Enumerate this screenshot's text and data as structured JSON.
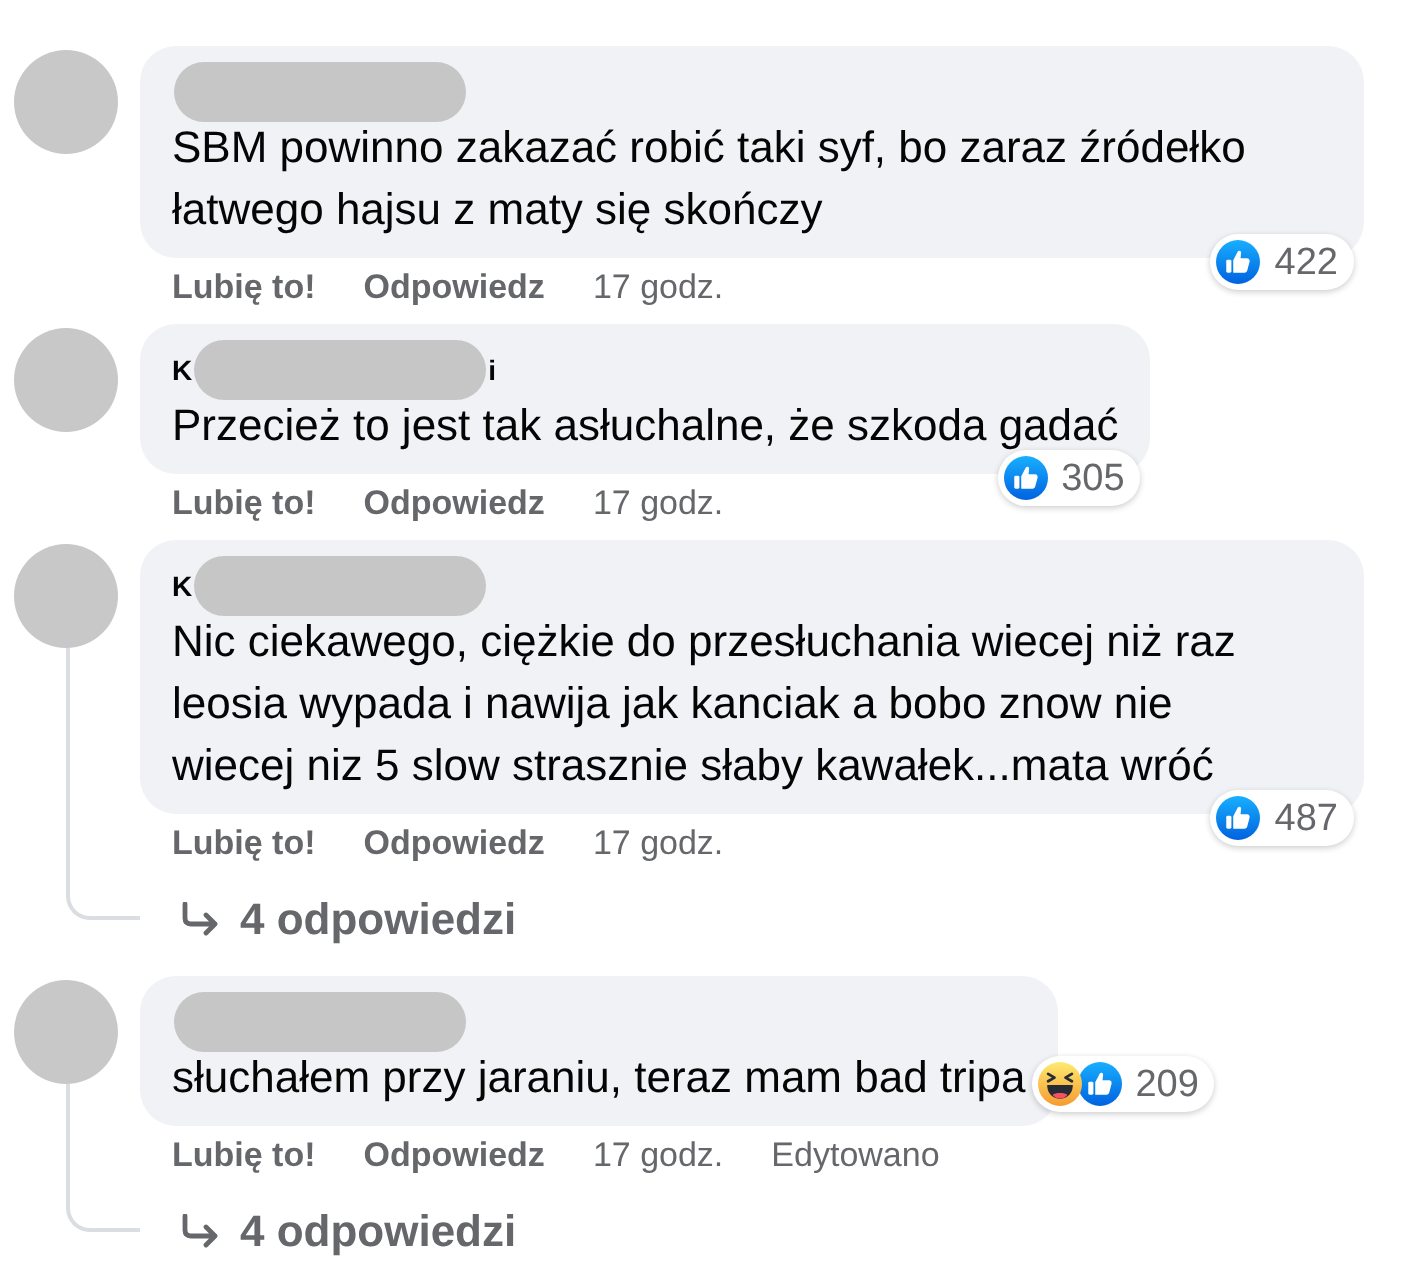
{
  "comments": [
    {
      "text_lines": [
        "SBM powinno zakazać robić taki syf, bo zaraz źródełko",
        "łatwego hajsu z maty się skończy"
      ],
      "reactions": [
        {
          "kind": "like"
        }
      ],
      "reaction_count": "422",
      "like_label": "Lubię to!",
      "reply_label": "Odpowiedz",
      "time": "17 godz."
    },
    {
      "name_fragments": {
        "start": "K",
        "end": "i"
      },
      "text_lines": [
        "Przecież to jest tak asłuchalne, że szkoda gadać"
      ],
      "reactions": [
        {
          "kind": "like"
        }
      ],
      "reaction_count": "305",
      "like_label": "Lubię to!",
      "reply_label": "Odpowiedz",
      "time": "17 godz."
    },
    {
      "name_fragments": {
        "start": "K"
      },
      "text_lines": [
        "Nic ciekawego, ciężkie do przesłuchania wiecej niż raz",
        "leosia wypada i nawija jak kanciak a bobo znow nie",
        "wiecej niz 5 slow strasznie słaby kawałek...mata wróć"
      ],
      "reactions": [
        {
          "kind": "like"
        }
      ],
      "reaction_count": "487",
      "like_label": "Lubię to!",
      "reply_label": "Odpowiedz",
      "time": "17 godz.",
      "replies": {
        "label": "4 odpowiedzi"
      }
    },
    {
      "text_lines": [
        "słuchałem przy jaraniu, teraz mam bad tripa"
      ],
      "reactions": [
        {
          "kind": "haha"
        },
        {
          "kind": "like"
        }
      ],
      "reaction_count": "209",
      "like_label": "Lubię to!",
      "reply_label": "Odpowiedz",
      "time": "17 godz.",
      "edited": "Edytowano",
      "replies": {
        "label": "4 odpowiedzi"
      }
    }
  ]
}
